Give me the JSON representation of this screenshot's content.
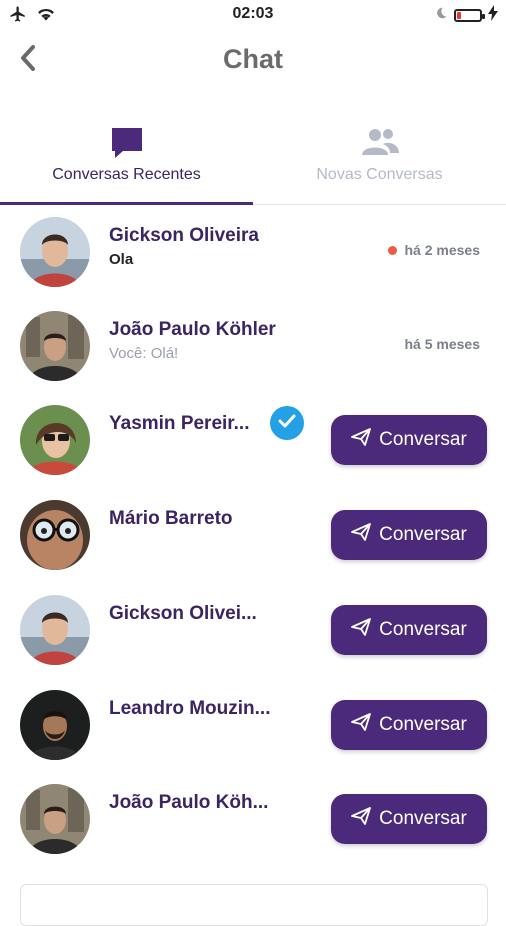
{
  "status_bar": {
    "time": "02:03",
    "icons": [
      "airplane-icon",
      "wifi-icon",
      "moon-icon",
      "battery-icon",
      "charging-icon"
    ],
    "battery_level": 0.15
  },
  "header": {
    "title": "Chat",
    "back_icon": "chevron-left-icon"
  },
  "tabs": [
    {
      "label": "Conversas Recentes",
      "icon": "chat-bubble-icon",
      "active": true
    },
    {
      "label": "Novas Conversas",
      "icon": "users-icon",
      "active": false
    }
  ],
  "recent_conversations": [
    {
      "name": "Gickson Oliveira",
      "last_message": "Ola",
      "time": "há 2 meses",
      "unread": true
    },
    {
      "name": "João Paulo Köhler",
      "last_message": "Você: Olá!",
      "time": "há 5 meses",
      "unread": false
    }
  ],
  "suggested_contacts": [
    {
      "name": "Yasmin  Pereir...",
      "verified": true,
      "button_label": "Conversar"
    },
    {
      "name": "Mário Barreto",
      "verified": false,
      "button_label": "Conversar"
    },
    {
      "name": "Gickson Olivei...",
      "verified": false,
      "button_label": "Conversar"
    },
    {
      "name": "Leandro Mouzin...",
      "verified": false,
      "button_label": "Conversar"
    },
    {
      "name": "João Paulo Köh...",
      "verified": false,
      "button_label": "Conversar"
    }
  ],
  "colors": {
    "accent": "#4b2a7b",
    "title_gray": "#6b6b6b",
    "inactive_tab": "#b4bac6",
    "unread_dot": "#ee5a3f",
    "verified_badge": "#23a0e6"
  }
}
